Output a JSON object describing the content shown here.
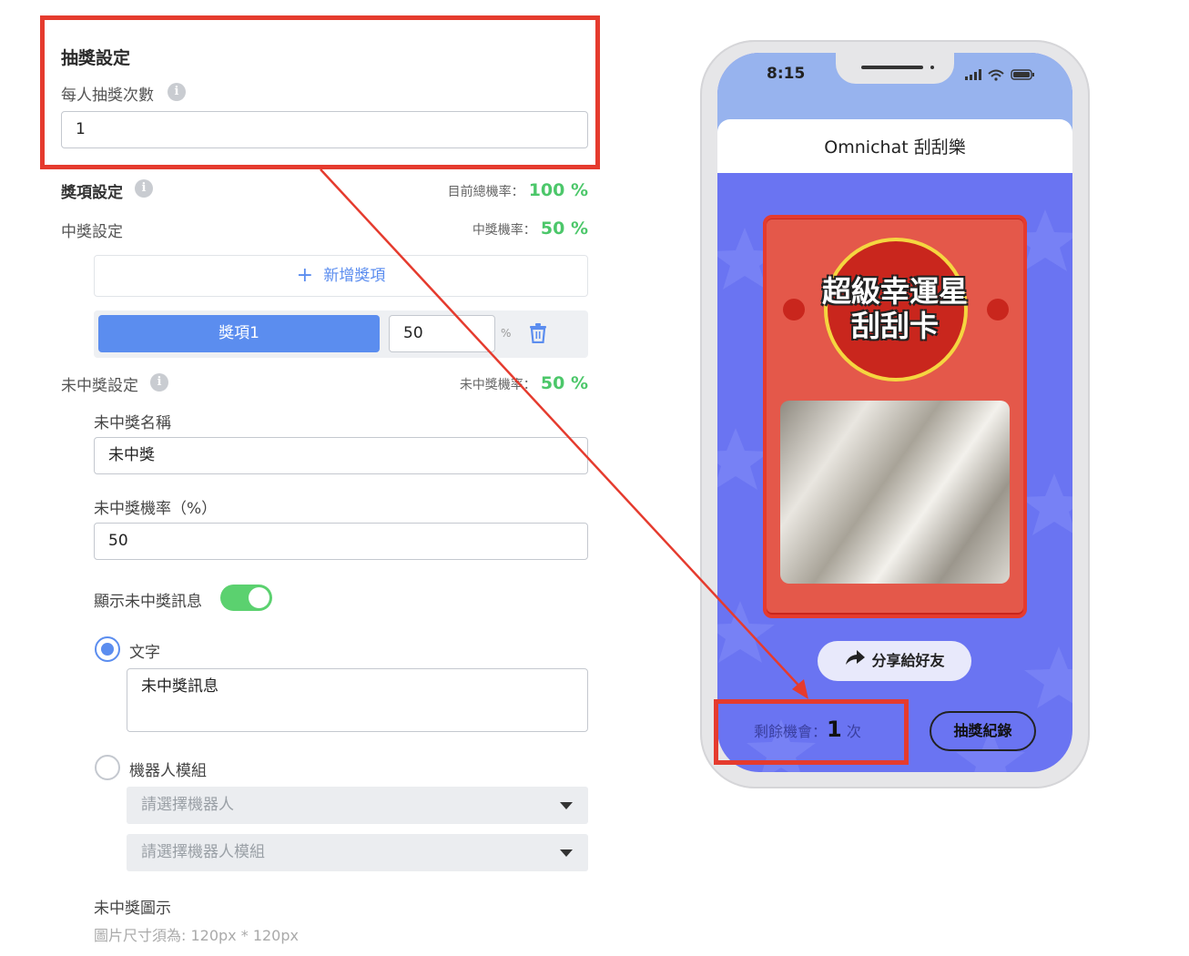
{
  "lottery_settings": {
    "title": "抽獎設定",
    "draws_per_person_label": "每人抽獎次數",
    "draws_per_person_value": "1"
  },
  "prize_settings": {
    "title": "獎項設定",
    "total_rate_label": "目前總機率：",
    "total_rate_value": "100 %",
    "win_settings_label": "中獎設定",
    "win_rate_label": "中獎機率：",
    "win_rate_value": "50 %",
    "add_prize_label": "新增獎項",
    "prizes": [
      {
        "name": "獎項1",
        "rate": "50",
        "unit": "%"
      }
    ]
  },
  "no_win_settings": {
    "title": "未中獎設定",
    "rate_label": "未中獎機率：",
    "rate_value": "50 %",
    "name_label": "未中獎名稱",
    "name_value": "未中獎",
    "probability_label": "未中獎機率（%）",
    "probability_value": "50",
    "show_message_label": "顯示未中獎訊息",
    "show_message_on": true,
    "option_text_label": "文字",
    "message_value": "未中獎訊息",
    "option_bot_label": "機器人模組",
    "select_bot_placeholder": "請選擇機器人",
    "select_bot_module_placeholder": "請選擇機器人模組",
    "icon_label": "未中獎圖示",
    "icon_hint": "圖片尺寸須為: 120px * 120px"
  },
  "phone": {
    "time": "8:15",
    "header_title": "Omnichat 刮刮樂",
    "card_title_line1": "超級幸運星",
    "card_title_line2": "刮刮卡",
    "share_label": "分享給好友",
    "remaining_label": "剩餘機會：",
    "remaining_count": "1",
    "remaining_unit": "次",
    "history_label": "抽獎紀錄"
  },
  "colors": {
    "accent_blue": "#5b8def",
    "success_green": "#4cc76a",
    "highlight_red": "#e53b2e",
    "phone_bg": "#6a74f2"
  }
}
